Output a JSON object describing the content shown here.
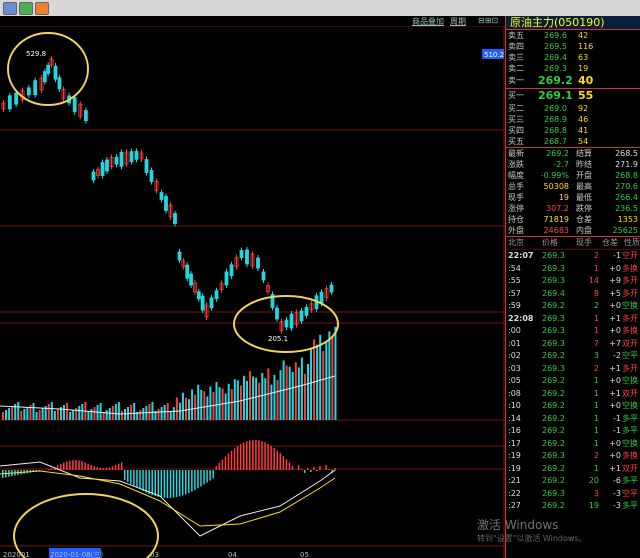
{
  "header": {
    "link_add": "商品叠加",
    "link_cycle": "周期",
    "price_tag": "510.2"
  },
  "chart": {
    "high_label": "529.8",
    "low_label": "205.1",
    "dates": [
      "202001",
      "2020-01-08(三)",
      "03",
      "04",
      "05"
    ],
    "colors": {
      "up": "#ff3b3b",
      "down": "#22d8e0",
      "macd_pos": "#ff3b3b",
      "macd_neg": "#22d8e0",
      "highlight": "#f2d35a"
    }
  },
  "quote": {
    "title": "原油主力",
    "code": "(050190)",
    "asks": [
      {
        "label": "卖五",
        "price": "269.6",
        "vol": "42"
      },
      {
        "label": "卖四",
        "price": "269.5",
        "vol": "116"
      },
      {
        "label": "卖三",
        "price": "269.4",
        "vol": "63"
      },
      {
        "label": "卖二",
        "price": "269.3",
        "vol": "19"
      },
      {
        "label": "卖一",
        "price": "269.2",
        "vol": "40"
      }
    ],
    "bids": [
      {
        "label": "买一",
        "price": "269.1",
        "vol": "55"
      },
      {
        "label": "买二",
        "price": "269.0",
        "vol": "92"
      },
      {
        "label": "买三",
        "price": "268.9",
        "vol": "46"
      },
      {
        "label": "买四",
        "price": "268.8",
        "vol": "41"
      },
      {
        "label": "买五",
        "price": "268.7",
        "vol": "54"
      }
    ],
    "stats": [
      {
        "l1": "最新",
        "v1": "269.2",
        "c1": "green",
        "l2": "结算",
        "v2": "268.5",
        "c2": "white"
      },
      {
        "l1": "涨跌",
        "v1": "-2.7",
        "c1": "green",
        "l2": "昨结",
        "v2": "271.9",
        "c2": "white"
      },
      {
        "l1": "幅度",
        "v1": "-0.99%",
        "c1": "green",
        "l2": "开盘",
        "v2": "268.8",
        "c2": "green"
      },
      {
        "l1": "总手",
        "v1": "50308",
        "c1": "yellow",
        "l2": "最高",
        "v2": "270.6",
        "c2": "green"
      },
      {
        "l1": "现手",
        "v1": "19",
        "c1": "yellow",
        "l2": "最低",
        "v2": "266.4",
        "c2": "green"
      },
      {
        "l1": "涨停",
        "v1": "307.2",
        "c1": "red",
        "l2": "跌停",
        "v2": "236.5",
        "c2": "green"
      },
      {
        "l1": "持仓",
        "v1": "71819",
        "c1": "yellow",
        "l2": "仓差",
        "v2": "1353",
        "c2": "yellow"
      },
      {
        "l1": "外盘",
        "v1": "24683",
        "c1": "red",
        "l2": "内盘",
        "v2": "25625",
        "c2": "green"
      }
    ],
    "tick_header": {
      "city": "北京",
      "price": "价格",
      "vol": "现手",
      "oi": "仓差",
      "nature": "性质"
    },
    "ticks": [
      {
        "time": "22:07",
        "price": "269.3",
        "pc": "green",
        "vol": "2",
        "vc": "red",
        "oi": "-1",
        "nature": "空开",
        "nc": "red"
      },
      {
        "time": ":54",
        "price": "269.3",
        "pc": "green",
        "vol": "1",
        "vc": "red",
        "oi": "+0",
        "nature": "多换",
        "nc": "red"
      },
      {
        "time": ":55",
        "price": "269.3",
        "pc": "green",
        "vol": "14",
        "vc": "red",
        "oi": "+9",
        "nature": "多开",
        "nc": "red"
      },
      {
        "time": ":57",
        "price": "269.4",
        "pc": "green",
        "vol": "8",
        "vc": "red",
        "oi": "+5",
        "nature": "多开",
        "nc": "red"
      },
      {
        "time": ":59",
        "price": "269.2",
        "pc": "green",
        "vol": "2",
        "vc": "green",
        "oi": "+0",
        "nature": "空换",
        "nc": "green"
      },
      {
        "time": "22:08",
        "price": "269.3",
        "pc": "green",
        "vol": "1",
        "vc": "red",
        "oi": "+1",
        "nature": "多开",
        "nc": "red"
      },
      {
        "time": ":00",
        "price": "269.3",
        "pc": "green",
        "vol": "1",
        "vc": "red",
        "oi": "+0",
        "nature": "多换",
        "nc": "red"
      },
      {
        "time": ":01",
        "price": "269.3",
        "pc": "green",
        "vol": "7",
        "vc": "red",
        "oi": "+7",
        "nature": "双开",
        "nc": "red"
      },
      {
        "time": ":02",
        "price": "269.2",
        "pc": "green",
        "vol": "3",
        "vc": "green",
        "oi": "-2",
        "nature": "空平",
        "nc": "green"
      },
      {
        "time": ":03",
        "price": "269.3",
        "pc": "green",
        "vol": "2",
        "vc": "red",
        "oi": "+1",
        "nature": "多开",
        "nc": "red"
      },
      {
        "time": ":05",
        "price": "269.2",
        "pc": "green",
        "vol": "1",
        "vc": "green",
        "oi": "+0",
        "nature": "空换",
        "nc": "green"
      },
      {
        "time": ":08",
        "price": "269.2",
        "pc": "green",
        "vol": "1",
        "vc": "green",
        "oi": "+1",
        "nature": "双开",
        "nc": "red"
      },
      {
        "time": ":10",
        "price": "269.2",
        "pc": "green",
        "vol": "1",
        "vc": "green",
        "oi": "+0",
        "nature": "空换",
        "nc": "green"
      },
      {
        "time": ":14",
        "price": "269.2",
        "pc": "green",
        "vol": "1",
        "vc": "green",
        "oi": "-1",
        "nature": "多平",
        "nc": "green"
      },
      {
        "time": ":16",
        "price": "269.2",
        "pc": "green",
        "vol": "1",
        "vc": "green",
        "oi": "-1",
        "nature": "多平",
        "nc": "green"
      },
      {
        "time": ":17",
        "price": "269.2",
        "pc": "green",
        "vol": "1",
        "vc": "green",
        "oi": "+0",
        "nature": "空换",
        "nc": "green"
      },
      {
        "time": ":19",
        "price": "269.3",
        "pc": "green",
        "vol": "2",
        "vc": "red",
        "oi": "+0",
        "nature": "多换",
        "nc": "red"
      },
      {
        "time": ":19",
        "price": "269.2",
        "pc": "green",
        "vol": "1",
        "vc": "green",
        "oi": "+1",
        "nature": "双开",
        "nc": "red"
      },
      {
        "time": ":21",
        "price": "269.2",
        "pc": "green",
        "vol": "20",
        "vc": "green",
        "oi": "-6",
        "nature": "多平",
        "nc": "green"
      },
      {
        "time": ":22",
        "price": "269.3",
        "pc": "green",
        "vol": "3",
        "vc": "red",
        "oi": "-3",
        "nature": "空平",
        "nc": "red"
      },
      {
        "time": ":27",
        "price": "269.2",
        "pc": "green",
        "vol": "19",
        "vc": "green",
        "oi": "-3",
        "nature": "多平",
        "nc": "green"
      }
    ]
  },
  "watermark": {
    "line1": "激活 Windows",
    "line2": "转到\"设置\"以激活 Windows。"
  }
}
